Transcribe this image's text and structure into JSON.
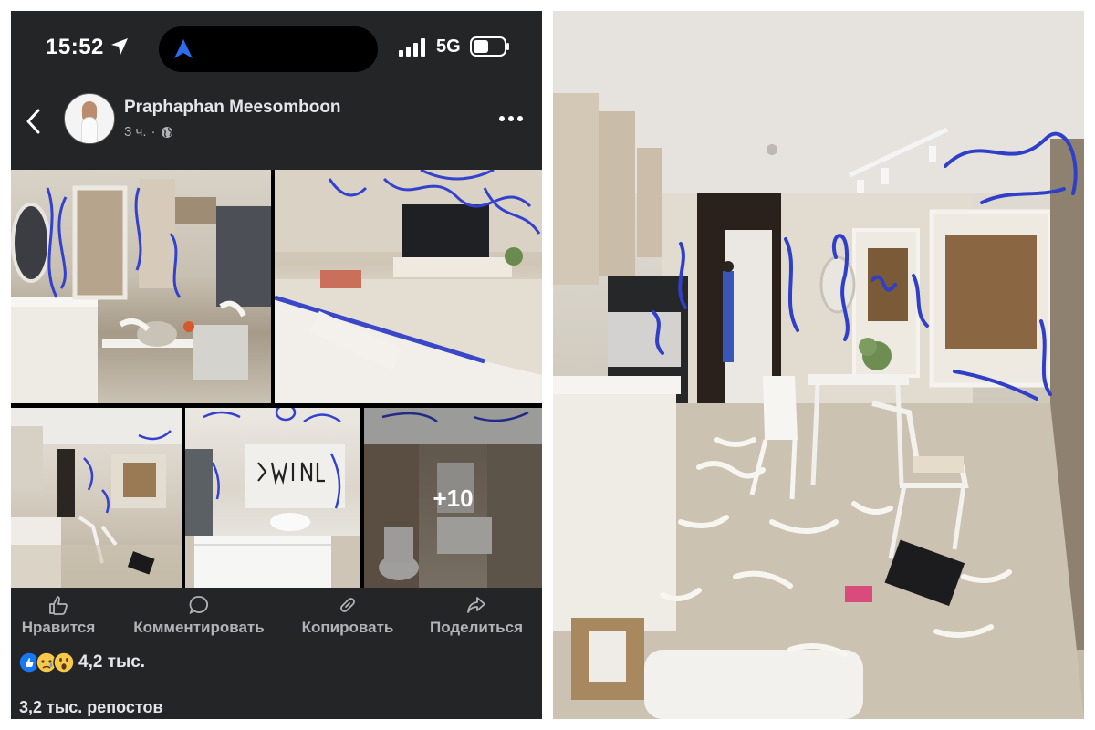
{
  "status_bar": {
    "time": "15:52",
    "network": "5G"
  },
  "post": {
    "author": "Praphaphan Meesomboon",
    "time_ago": "3 ч.",
    "more_photos": "+10",
    "reactions_count": "4,2 тыс.",
    "reposts": "3,2 тыс. репостов"
  },
  "actions": {
    "like": "Нравится",
    "comment": "Комментировать",
    "copy": "Копировать",
    "share": "Поделиться"
  },
  "icons": {
    "back": "chevron-left-icon",
    "more": "more-horizontal-icon",
    "audience": "globe-icon",
    "like": "thumbs-up-icon",
    "comment": "speech-bubble-icon",
    "copy": "link-icon",
    "share": "share-arrow-icon",
    "reactions": [
      "like-reaction-icon",
      "sad-reaction-icon",
      "wow-reaction-icon"
    ]
  },
  "colors": {
    "app_background": "#242526",
    "primary_text": "#e4e6eb",
    "secondary_text": "#b0b3b8",
    "graffiti_paint": "#2f3fc8",
    "like_blue": "#1877f2",
    "reaction_yellow": "#f7c84b"
  }
}
